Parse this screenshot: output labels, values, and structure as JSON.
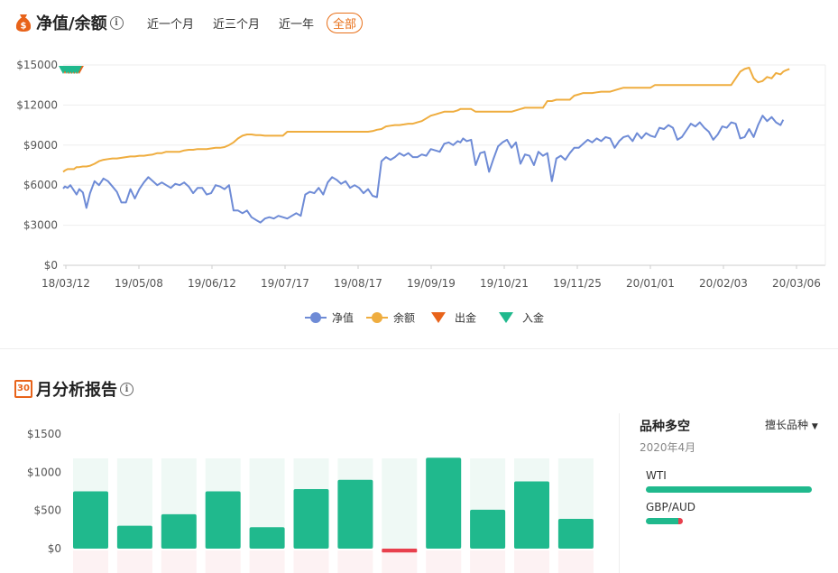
{
  "header": {
    "title": "净值/余额",
    "info_icon": "info-icon"
  },
  "range_tabs": [
    {
      "label": "近一个月",
      "active": false
    },
    {
      "label": "近三个月",
      "active": false
    },
    {
      "label": "近一年",
      "active": false
    },
    {
      "label": "全部",
      "active": true
    }
  ],
  "colors": {
    "equity": "#6e8bd6",
    "balance": "#efad3f",
    "withdraw": "#e8631a",
    "deposit": "#20b98d",
    "accent": "#e8701a"
  },
  "chart_data": [
    {
      "type": "line",
      "x_ticks": [
        "18/03/12",
        "19/05/08",
        "19/06/12",
        "19/07/17",
        "19/08/17",
        "19/09/19",
        "19/10/21",
        "19/11/25",
        "20/01/01",
        "20/02/03",
        "20/03/06"
      ],
      "y_ticks": [
        "$0",
        "$3000",
        "$6000",
        "$9000",
        "$12000",
        "$15000"
      ],
      "ylim": [
        0,
        15000
      ],
      "x": [
        0,
        2,
        5,
        8,
        12,
        15,
        18,
        22,
        26,
        30,
        35,
        40,
        45,
        50,
        55,
        60,
        65,
        70,
        75,
        80,
        85,
        90,
        95,
        100,
        105,
        110,
        115,
        120,
        125,
        130,
        135,
        140,
        145,
        150,
        155,
        160,
        165,
        170,
        175,
        180,
        185,
        190,
        195,
        200,
        205,
        210,
        215,
        220,
        225,
        230,
        235,
        240,
        245,
        250,
        255,
        260,
        265,
        270,
        275,
        280,
        285,
        290,
        295,
        300,
        305,
        310,
        315,
        320,
        325,
        330,
        335,
        340,
        345,
        350,
        355,
        360,
        365,
        370,
        375,
        380,
        385,
        390,
        395,
        400,
        405,
        410,
        415,
        420,
        425,
        430,
        435,
        440,
        443,
        446,
        450,
        455,
        460,
        465,
        470,
        475,
        480,
        485,
        490,
        495,
        500,
        505,
        510,
        515,
        520,
        525,
        530,
        535,
        540,
        545,
        550,
        555,
        560,
        565,
        570,
        575,
        580,
        585,
        590,
        595,
        600,
        605,
        610,
        615,
        620,
        625,
        630,
        635,
        640,
        645,
        650,
        655,
        660,
        665,
        670,
        675,
        680,
        685,
        690,
        695,
        700,
        705,
        710,
        715,
        720,
        725,
        730,
        735,
        740,
        745,
        750,
        755,
        760,
        765,
        770,
        775,
        780,
        785,
        790,
        795,
        800,
        803,
        806,
        810,
        815,
        820,
        825,
        830,
        835,
        840,
        845,
        850
      ],
      "series": [
        {
          "name": "净值",
          "values": [
            5750,
            5900,
            5800,
            6000,
            5600,
            5300,
            5700,
            5450,
            4300,
            5400,
            6300,
            6000,
            6500,
            6300,
            5900,
            5500,
            4700,
            4700,
            5700,
            5000,
            5700,
            6200,
            6600,
            6300,
            6000,
            6200,
            6000,
            5800,
            6100,
            6000,
            6200,
            5900,
            5400,
            5800,
            5800,
            5300,
            5400,
            6000,
            5900,
            5700,
            6000,
            4100,
            4100,
            3900,
            4100,
            3600,
            3400,
            3200,
            3500,
            3600,
            3500,
            3700,
            3600,
            3500,
            3700,
            3900,
            3700,
            5300,
            5500,
            5400,
            5800,
            5300,
            6200,
            6600,
            6400,
            6100,
            6300,
            5800,
            6000,
            5800,
            5400,
            5700,
            5200,
            5100,
            7800,
            8100,
            7900,
            8100,
            8400,
            8200,
            8400,
            8100,
            8100,
            8300,
            8200,
            8700,
            8600,
            8500,
            9100,
            9200,
            9000,
            9300,
            9200,
            9500,
            9300,
            9400,
            7500,
            8400,
            8500,
            7000,
            8000,
            8900,
            9200,
            9400,
            8800,
            9200,
            7600,
            8300,
            8200,
            7500,
            8500,
            8200,
            8400,
            6300,
            8000,
            8200,
            7900,
            8400,
            8800,
            8800,
            9100,
            9400,
            9200,
            9500,
            9300,
            9600,
            9500,
            8800,
            9300,
            9600,
            9700,
            9300,
            9900,
            9500,
            9900,
            9700,
            9600,
            10300,
            10200,
            10500,
            10300,
            9400,
            9600,
            10100,
            10600,
            10400,
            10700,
            10300,
            10000,
            9400,
            9800,
            10400,
            10300,
            10700,
            10600,
            9500,
            9600,
            10200,
            9600,
            10500,
            11200,
            10800,
            11100,
            10700,
            10500,
            10900
          ]
        },
        {
          "name": "余额",
          "values": [
            7000,
            7100,
            7200,
            7200,
            7200,
            7350,
            7350,
            7400,
            7400,
            7450,
            7600,
            7800,
            7900,
            7950,
            8000,
            8000,
            8050,
            8100,
            8150,
            8150,
            8200,
            8200,
            8250,
            8300,
            8400,
            8400,
            8500,
            8500,
            8500,
            8500,
            8600,
            8650,
            8650,
            8700,
            8700,
            8700,
            8750,
            8800,
            8800,
            8850,
            9000,
            9200,
            9500,
            9700,
            9800,
            9800,
            9750,
            9750,
            9700,
            9700,
            9700,
            9700,
            9700,
            10000,
            10000,
            10000,
            10000,
            10000,
            10000,
            10000,
            10000,
            10000,
            10000,
            10000,
            10000,
            10000,
            10000,
            10000,
            10000,
            10000,
            10000,
            10000,
            10050,
            10150,
            10200,
            10400,
            10450,
            10500,
            10500,
            10550,
            10600,
            10600,
            10700,
            10800,
            11000,
            11200,
            11300,
            11400,
            11500,
            11500,
            11500,
            11600,
            11700,
            11700,
            11700,
            11700,
            11500,
            11500,
            11500,
            11500,
            11500,
            11500,
            11500,
            11500,
            11500,
            11600,
            11700,
            11800,
            11800,
            11800,
            11800,
            11800,
            12300,
            12300,
            12400,
            12400,
            12400,
            12400,
            12700,
            12800,
            12900,
            12900,
            12900,
            12950,
            13000,
            13000,
            13000,
            13100,
            13200,
            13300,
            13300,
            13300,
            13300,
            13300,
            13300,
            13300,
            13500,
            13500,
            13500,
            13500,
            13500,
            13500,
            13500,
            13500,
            13500,
            13500,
            13500,
            13500,
            13500,
            13500,
            13500,
            13500,
            13500,
            13500,
            14000,
            14500,
            14700,
            14800,
            14000,
            13700,
            13800,
            14100,
            14000,
            14400,
            14300,
            14500,
            14600,
            14700
          ]
        }
      ],
      "markers": [
        {
          "name": "出金",
          "x": [
            2,
            6,
            9,
            12,
            15,
            18
          ]
        },
        {
          "name": "入金",
          "x": [
            0,
            4,
            7,
            10,
            13,
            16
          ]
        }
      ],
      "legend": [
        {
          "label": "净值",
          "marker": "circle",
          "color": "#6e8bd6"
        },
        {
          "label": "余额",
          "marker": "circle",
          "color": "#efad3f"
        },
        {
          "label": "出金",
          "marker": "triangle-down",
          "color": "#e8631a"
        },
        {
          "label": "入金",
          "marker": "triangle-down",
          "color": "#20b98d"
        }
      ],
      "legend_position": "bottom",
      "grid": true
    },
    {
      "type": "bar",
      "y_ticks": [
        "$1500",
        "$1000",
        "$500",
        "$0"
      ],
      "ylim": [
        0,
        1500
      ],
      "values": [
        750,
        300,
        450,
        750,
        280,
        780,
        900,
        -50,
        1190,
        510,
        880,
        390
      ],
      "colors": [
        "#20b98d",
        "#20b98d",
        "#20b98d",
        "#20b98d",
        "#20b98d",
        "#20b98d",
        "#20b98d",
        "#e8404d",
        "#20b98d",
        "#20b98d",
        "#20b98d",
        "#20b98d"
      ]
    }
  ],
  "monthly_report": {
    "title": "月分析报告",
    "icon_text": "30",
    "info_icon": "info-icon"
  },
  "side_panel": {
    "title": "品种多空",
    "subtitle": "2020年4月",
    "dropdown_label": "擅长品种",
    "symbols": [
      {
        "name": "WTI",
        "long": 1.0,
        "short": 0.0
      },
      {
        "name": "GBP/AUD",
        "long": 0.88,
        "short": 0.12
      }
    ]
  }
}
